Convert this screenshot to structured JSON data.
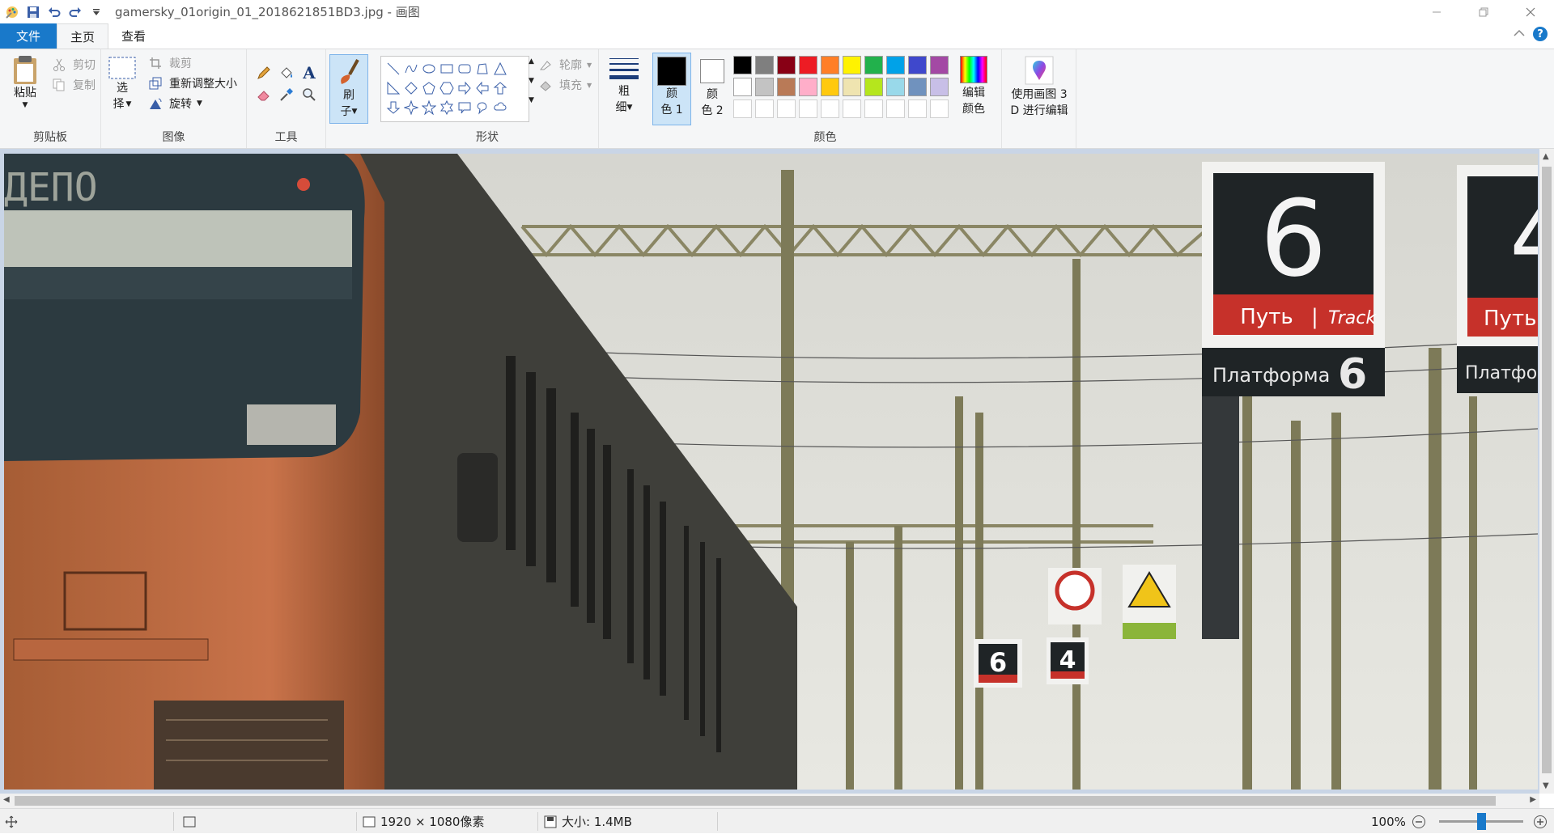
{
  "window": {
    "title": "gamersky_01origin_01_2018621851BD3.jpg - 画图",
    "minimize": "minimize-icon",
    "restore": "restore-icon",
    "close": "close-icon"
  },
  "tabs": {
    "file": "文件",
    "home": "主页",
    "view": "查看"
  },
  "ribbon": {
    "clipboard": {
      "label": "剪贴板",
      "paste": "粘贴",
      "cut": "剪切",
      "copy": "复制"
    },
    "image": {
      "label": "图像",
      "select_1": "选",
      "select_2": "择",
      "crop": "裁剪",
      "resize": "重新调整大小",
      "rotate": "旋转"
    },
    "tools": {
      "label": "工具"
    },
    "brushes": {
      "label_1": "刷",
      "label_2": "子"
    },
    "shapes": {
      "label": "形状",
      "outline": "轮廓",
      "fill": "填充"
    },
    "size": {
      "label_1": "粗",
      "label_2": "细"
    },
    "colors": {
      "label": "颜色",
      "color1_a": "颜",
      "color1_b": "色 1",
      "color2_a": "颜",
      "color2_b": "色 2",
      "edit_1": "编辑",
      "edit_2": "颜色",
      "color1_value": "#000000",
      "color2_value": "#ffffff",
      "palette": [
        "#000000",
        "#7f7f7f",
        "#880015",
        "#ed1c24",
        "#ff7f27",
        "#fff200",
        "#22b14c",
        "#00a2e8",
        "#3f48cc",
        "#a349a4",
        "#ffffff",
        "#c3c3c3",
        "#b97a57",
        "#ffaec9",
        "#ffc90e",
        "#efe4b0",
        "#b5e61d",
        "#99d9ea",
        "#7092be",
        "#c8bfe7"
      ]
    },
    "paint3d": {
      "label_1": "使用画图 3",
      "label_2": "D 进行编辑"
    }
  },
  "image_text": {
    "depot": "ДЕПО",
    "sign_big_number": "6",
    "sign_track": "Путь",
    "sign_track_en": "Track",
    "sign_platform": "Платформа",
    "sign_platform_number": "6",
    "sign2_number": "4",
    "sign2_track": "Путь",
    "sign2_platform": "Платфо",
    "small_sign_6": "6",
    "small_sign_4": "4"
  },
  "status": {
    "dimensions": "1920 × 1080像素",
    "size": "大小: 1.4MB",
    "zoom": "100%",
    "zoom_level": 0.5
  }
}
